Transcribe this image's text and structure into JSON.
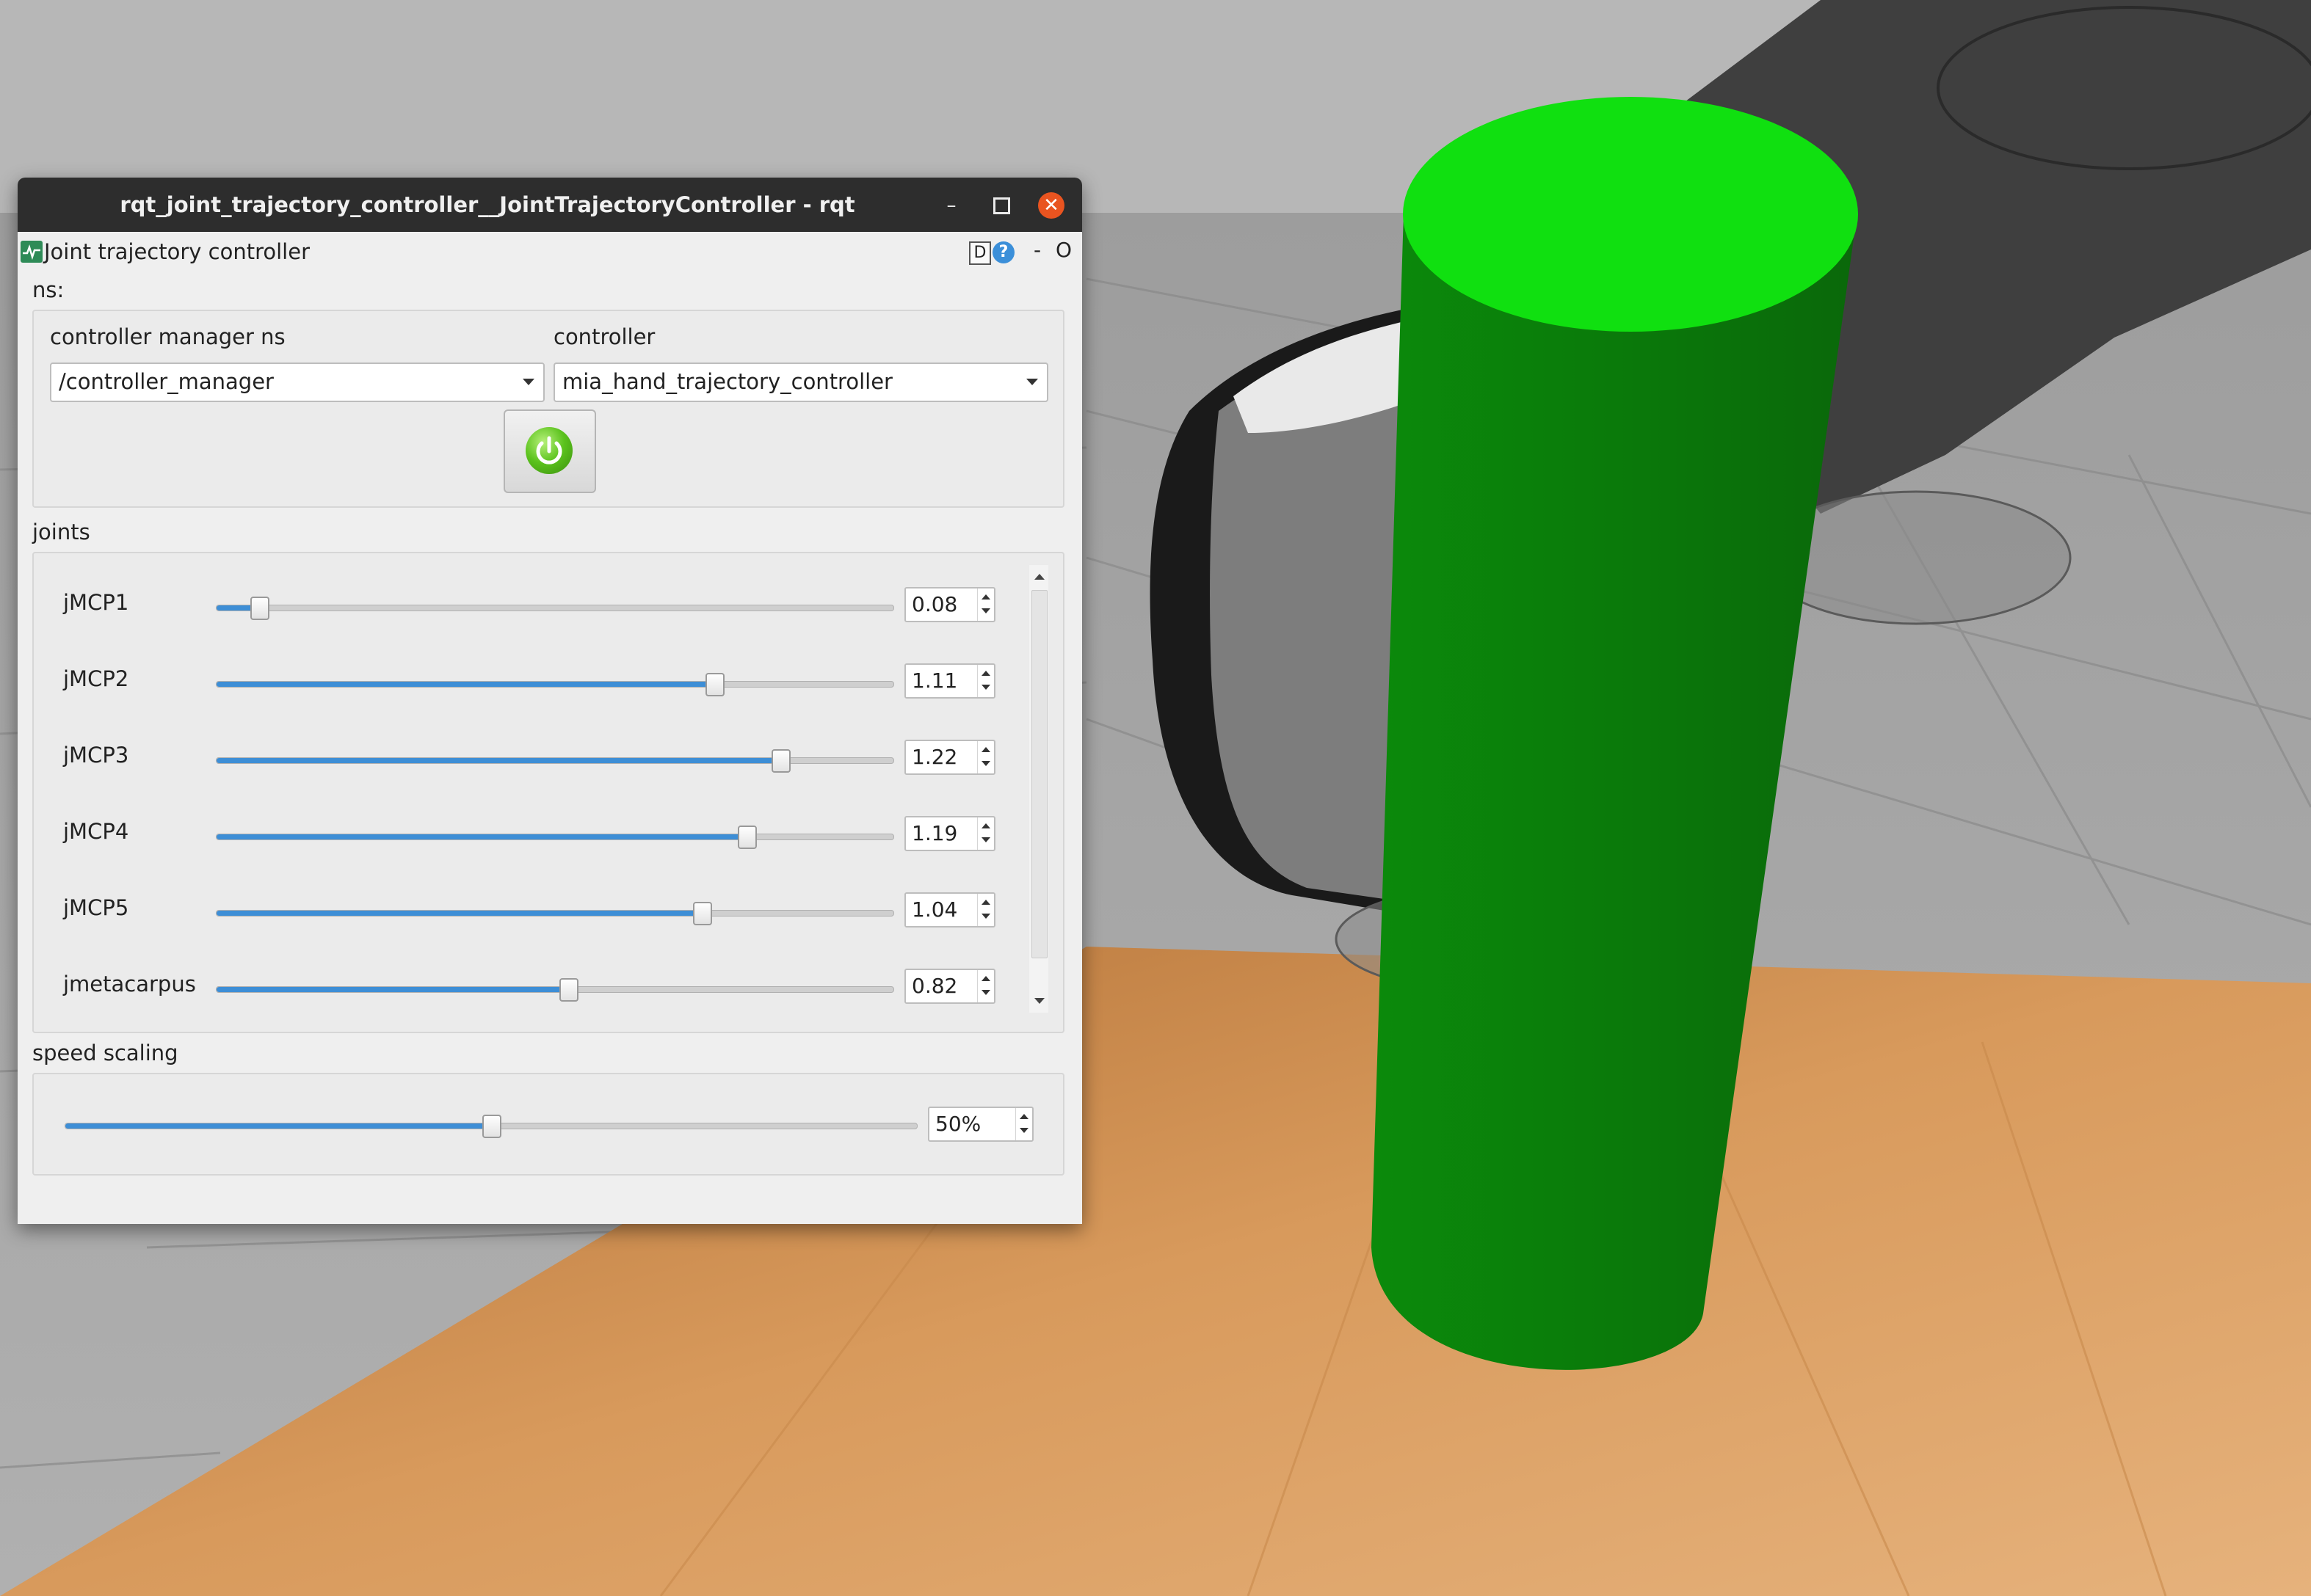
{
  "colors": {
    "accent": "#3d8ed6",
    "cylinder": "#0a9a0a",
    "cylinder_top": "#10e010",
    "close_button": "#e95420",
    "power_button": "#5bc21d"
  },
  "window": {
    "title": "rqt_joint_trajectory_controller__JointTrajectoryController - rqt",
    "minimize_symbol": "–",
    "maximize_icon": "maximize-icon",
    "close_symbol": "✕"
  },
  "plugin": {
    "title": "Joint trajectory controller",
    "icon": "plugin-icon",
    "d_label": "D",
    "help_label": "?",
    "dash_label": "-",
    "o_label": "O"
  },
  "ns": {
    "label": "ns:",
    "manager_label": "controller manager ns",
    "manager_value": "/controller_manager",
    "controller_label": "controller",
    "controller_value": "mia_hand_trajectory_controller",
    "power_icon": "power-icon"
  },
  "joints": {
    "label": "joints",
    "items": [
      {
        "name": "jMCP1",
        "value": "0.08",
        "fraction": 0.063
      },
      {
        "name": "jMCP2",
        "value": "1.11",
        "fraction": 0.735
      },
      {
        "name": "jMCP3",
        "value": "1.22",
        "fraction": 0.833
      },
      {
        "name": "jMCP4",
        "value": "1.19",
        "fraction": 0.783
      },
      {
        "name": "jMCP5",
        "value": "1.04",
        "fraction": 0.717
      },
      {
        "name": "jmetacarpus",
        "value": "0.82",
        "fraction": 0.52
      }
    ]
  },
  "speed": {
    "label": "speed scaling",
    "value": "50%",
    "fraction": 0.5
  }
}
